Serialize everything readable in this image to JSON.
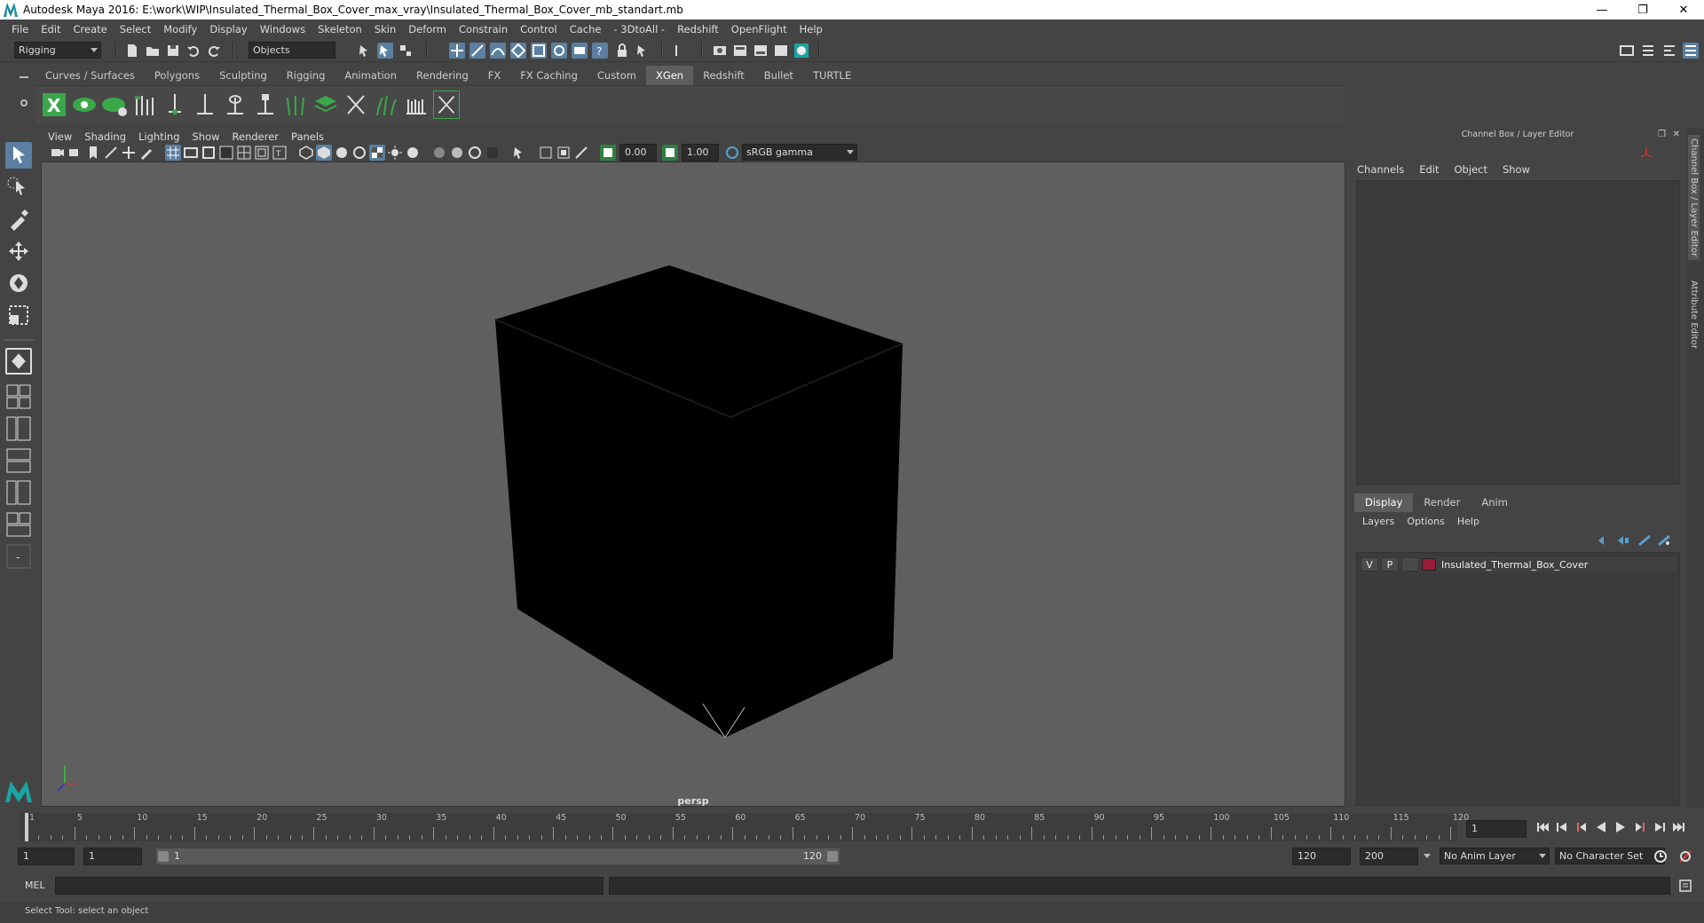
{
  "window": {
    "title": "Autodesk Maya 2016: E:\\work\\WIP\\Insulated_Thermal_Box_Cover_max_vray\\Insulated_Thermal_Box_Cover_mb_standart.mb",
    "minimize": "—",
    "restore": "❐",
    "close": "✕"
  },
  "menubar": [
    "File",
    "Edit",
    "Create",
    "Select",
    "Modify",
    "Display",
    "Windows",
    "Skeleton",
    "Skin",
    "Deform",
    "Constrain",
    "Control",
    "Cache",
    "- 3DtoAll -",
    "Redshift",
    "OpenFlight",
    "Help"
  ],
  "statusline": {
    "mode_dropdown": "Rigging",
    "selection_dropdown": "Objects"
  },
  "shelf": {
    "tabs": [
      "Curves / Surfaces",
      "Polygons",
      "Sculpting",
      "Rigging",
      "Animation",
      "Rendering",
      "FX",
      "FX Caching",
      "Custom",
      "XGen",
      "Redshift",
      "Bullet",
      "TURTLE"
    ],
    "active_tab": "XGen"
  },
  "viewport": {
    "menu": [
      "View",
      "Shading",
      "Lighting",
      "Show",
      "Renderer",
      "Panels"
    ],
    "exposure": "0.00",
    "gamma": "1.00",
    "colorspace": "sRGB gamma",
    "camera_label": "persp"
  },
  "channel_box": {
    "title": "Channel Box / Layer Editor",
    "menu": [
      "Channels",
      "Edit",
      "Object",
      "Show"
    ]
  },
  "layer_editor": {
    "tabs": [
      "Display",
      "Render",
      "Anim"
    ],
    "active_tab": "Display",
    "menu": [
      "Layers",
      "Options",
      "Help"
    ],
    "layers": [
      {
        "v": "V",
        "p": "P",
        "name": "Insulated_Thermal_Box_Cover",
        "color": "#9a1a3a"
      }
    ]
  },
  "side_tabs": [
    "Channel Box / Layer Editor",
    "Attribute Editor"
  ],
  "timeslider": {
    "labels": [
      "1",
      "5",
      "10",
      "15",
      "20",
      "25",
      "30",
      "35",
      "40",
      "45",
      "50",
      "55",
      "60",
      "65",
      "70",
      "75",
      "80",
      "85",
      "90",
      "95",
      "100",
      "105",
      "110",
      "115",
      "120"
    ],
    "current_frame": "1"
  },
  "range": {
    "start": "1",
    "playback_start": "1",
    "range_start_label": "1",
    "range_end_label": "120",
    "playback_end": "120",
    "end": "200",
    "anim_layer": "No Anim Layer",
    "character_set": "No Character Set"
  },
  "command_line": {
    "label": "MEL"
  },
  "help_line": "Select Tool: select an object"
}
